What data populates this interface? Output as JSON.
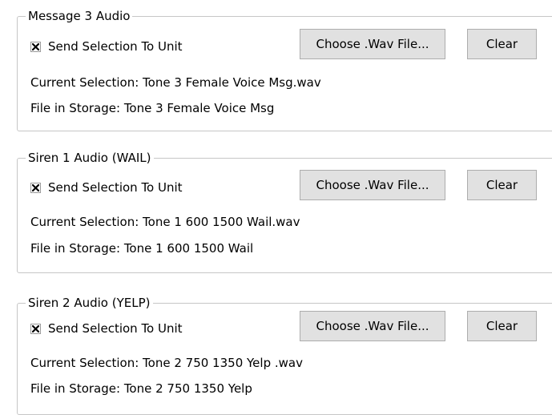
{
  "groups": [
    {
      "title": "Message 3 Audio",
      "send_label": "Send Selection To Unit",
      "send_checked": true,
      "choose_label": "Choose .Wav File...",
      "clear_label": "Clear",
      "current_selection": "Current Selection:  Tone 3 Female Voice Msg.wav",
      "file_in_storage": "File in Storage: Tone 3 Female Voice Msg"
    },
    {
      "title": "Siren 1 Audio (WAIL)",
      "send_label": "Send Selection To Unit",
      "send_checked": true,
      "choose_label": "Choose .Wav File...",
      "clear_label": "Clear",
      "current_selection": "Current Selection:  Tone 1 600 1500 Wail.wav",
      "file_in_storage": "File in Storage: Tone 1 600 1500 Wail"
    },
    {
      "title": "Siren 2 Audio (YELP)",
      "send_label": "Send Selection To Unit",
      "send_checked": true,
      "choose_label": "Choose .Wav File...",
      "clear_label": "Clear",
      "current_selection": "Current Selection:  Tone 2 750 1350 Yelp .wav",
      "file_in_storage": "File in Storage:  Tone 2 750 1350 Yelp"
    }
  ]
}
